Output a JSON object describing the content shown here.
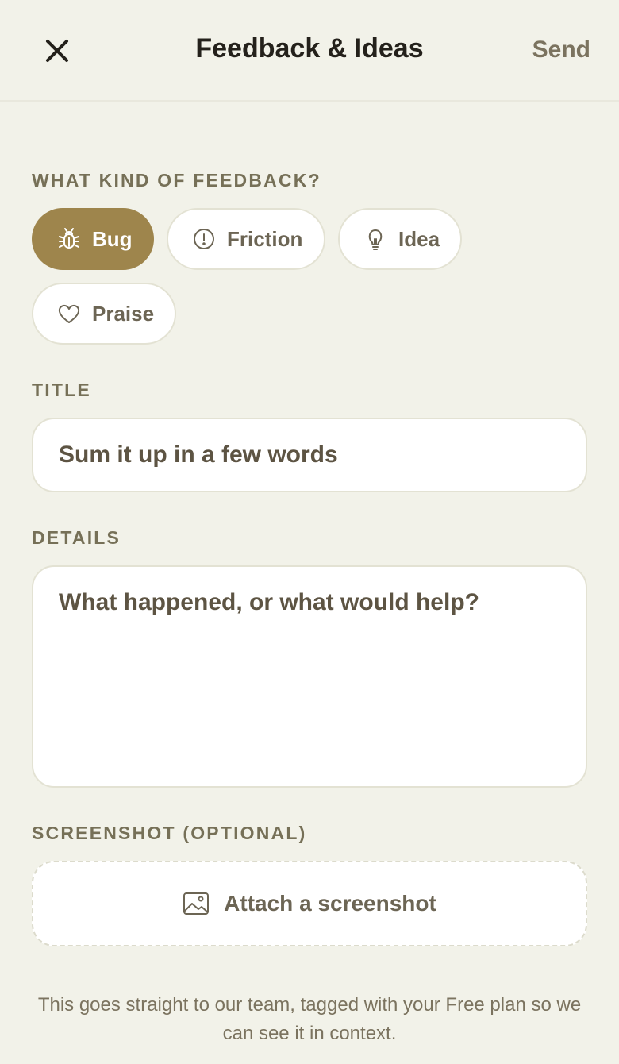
{
  "header": {
    "title": "Feedback & Ideas",
    "send_label": "Send",
    "close_icon": "close-icon"
  },
  "feedback_type": {
    "label": "WHAT KIND OF FEEDBACK?",
    "selected": "Bug",
    "options": [
      {
        "label": "Bug",
        "icon": "bug-icon"
      },
      {
        "label": "Friction",
        "icon": "alert-circle-icon"
      },
      {
        "label": "Idea",
        "icon": "lightbulb-icon"
      },
      {
        "label": "Praise",
        "icon": "heart-icon"
      }
    ]
  },
  "title_field": {
    "label": "TITLE",
    "placeholder": "Sum it up in a few words",
    "value": ""
  },
  "details_field": {
    "label": "DETAILS",
    "placeholder": "What happened, or what would help?",
    "value": ""
  },
  "screenshot": {
    "label": "SCREENSHOT (OPTIONAL)",
    "attach_label": "Attach a screenshot",
    "icon": "image-icon"
  },
  "footnote": "This goes straight to our team, tagged with your Free plan so we can see it in context.",
  "colors": {
    "background": "#f2f2e9",
    "accent": "#9e854c",
    "text_dark": "#24211b",
    "text_muted": "#767057"
  }
}
